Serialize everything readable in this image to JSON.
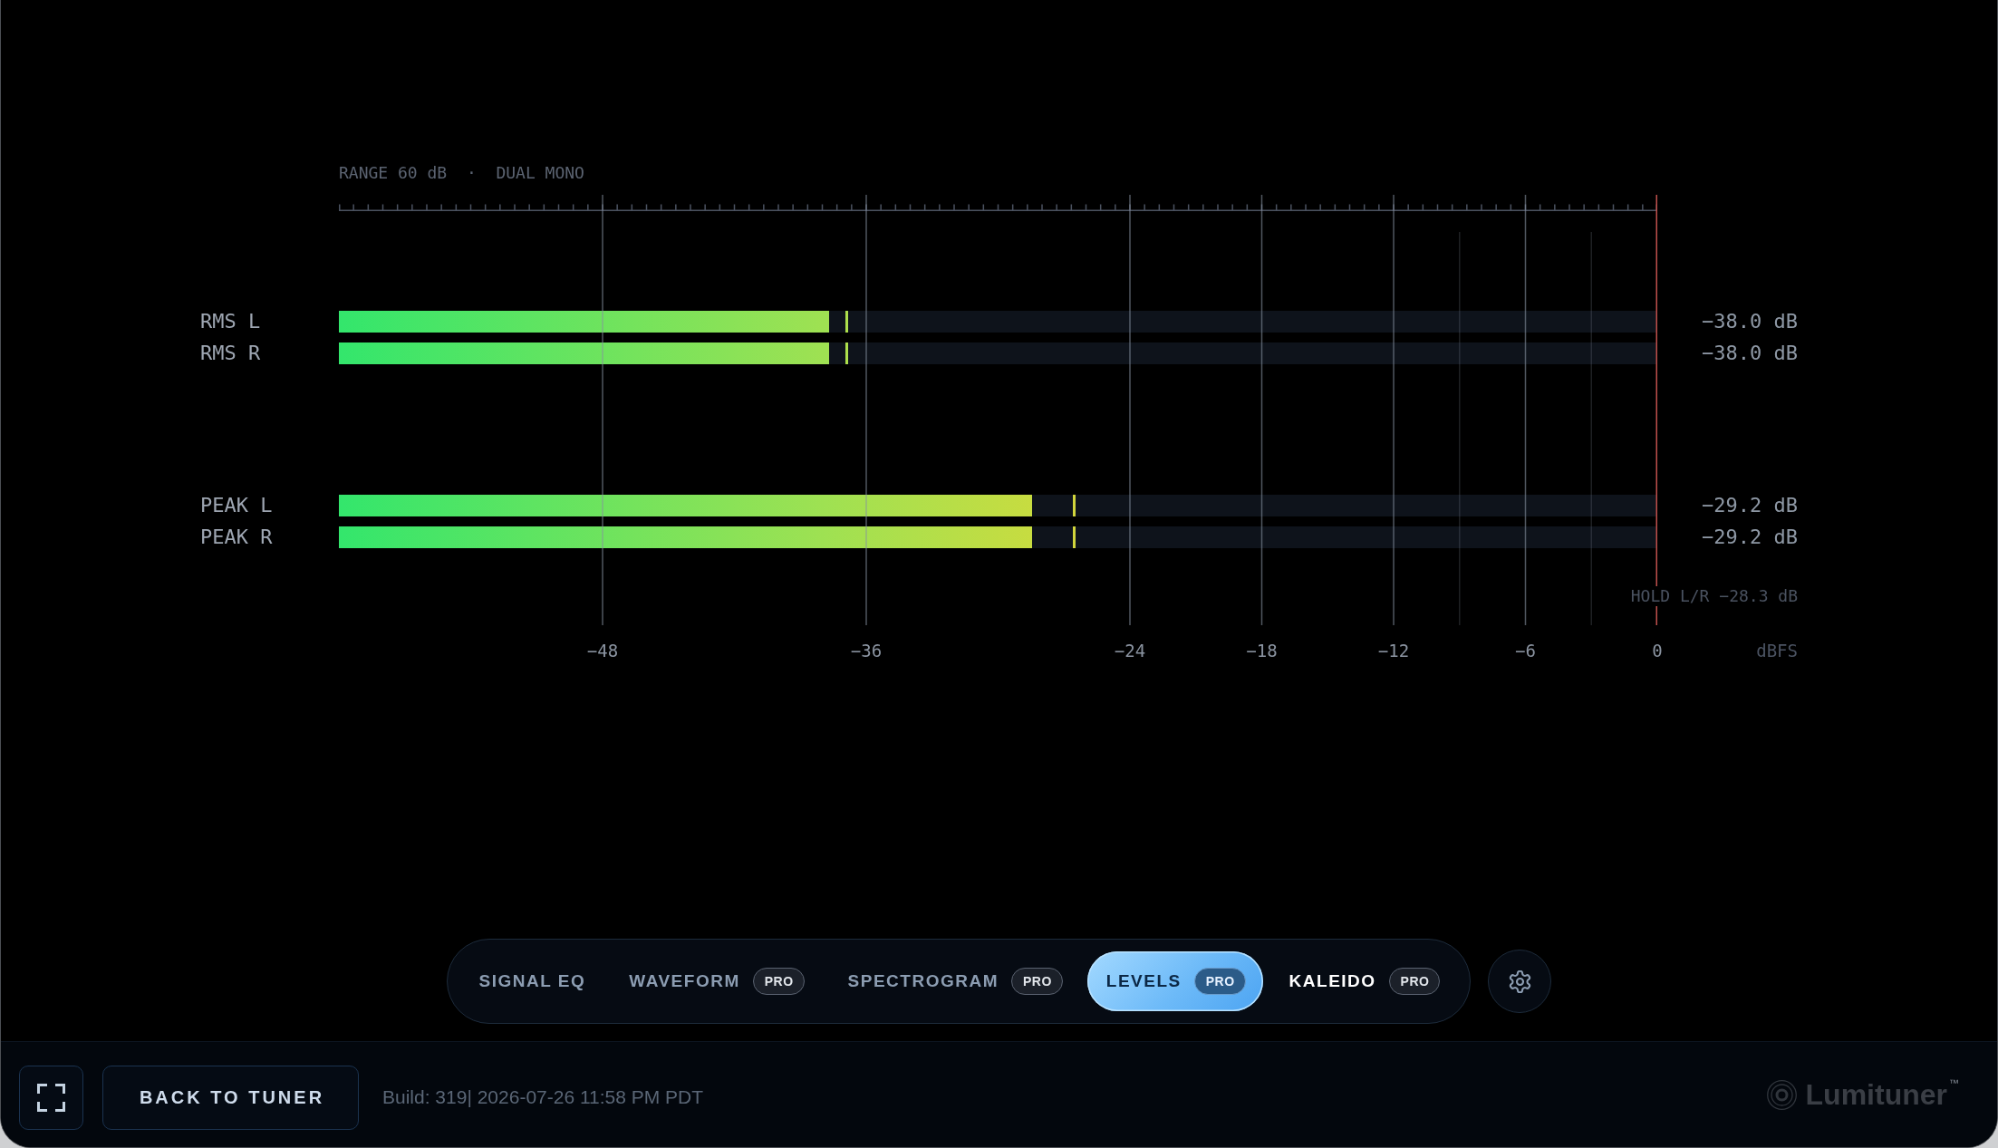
{
  "meter_panel": {
    "caption": "RANGE 60 dB  ·  DUAL MONO",
    "groups": [
      {
        "channels": [
          {
            "name": "RMS L",
            "fill": {
              "level": 0.372
            },
            "hold": {
              "level": 0.385
            },
            "reading": "−38.0 dB"
          },
          {
            "name": "RMS R",
            "fill": {
              "level": 0.372
            },
            "hold": {
              "level": 0.385
            },
            "reading": "−38.0 dB"
          }
        ]
      },
      {
        "channels": [
          {
            "name": "PEAK L",
            "fill": {
              "level": 0.526
            },
            "hold": {
              "level": 0.558
            },
            "reading": "−29.2 dB"
          },
          {
            "name": "PEAK R",
            "fill": {
              "level": 0.526
            },
            "hold": {
              "level": 0.558
            },
            "reading": "−29.2 dB"
          }
        ]
      }
    ],
    "hold_note": "HOLD L/R −28.3 dB",
    "axis": {
      "ticks": [
        "−48",
        "−36",
        "−24",
        "−18",
        "−12",
        "−6",
        "0"
      ],
      "unit": "dBFS"
    }
  },
  "mode_tabs": [
    {
      "label": "SIGNAL EQ",
      "selected": false,
      "highlighted": false
    },
    {
      "label": "WAVEFORM",
      "badge": "PRO",
      "selected": false,
      "highlighted": false
    },
    {
      "label": "SPECTROGRAM",
      "badge": "PRO",
      "selected": false,
      "highlighted": false
    },
    {
      "label": "LEVELS",
      "badge": "PRO",
      "selected": true,
      "highlighted": false
    },
    {
      "label": "KALEIDO",
      "badge": "PRO",
      "selected": false,
      "highlighted": true
    }
  ],
  "footer": {
    "back_button": "BACK TO TUNER",
    "build_info": "Build: 319| 2026-07-26 11:58 PM PDT",
    "logo": "Lumituner$^{™}$"
  }
}
